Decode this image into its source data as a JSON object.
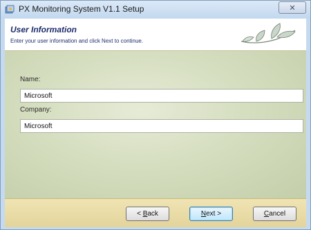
{
  "window": {
    "title": "PX Monitoring System V1.1 Setup",
    "close_glyph": "✕"
  },
  "header": {
    "title": "User Information",
    "subtitle": "Enter your user information and click Next to continue."
  },
  "form": {
    "name_label": "Name:",
    "name_value": "Microsoft",
    "company_label": "Company:",
    "company_value": "Microsoft"
  },
  "buttons": {
    "back": {
      "prefix": "< ",
      "mnemonic": "B",
      "rest": "ack"
    },
    "next": {
      "mnemonic": "N",
      "rest": "ext >"
    },
    "cancel": {
      "mnemonic": "C",
      "rest": "ancel"
    }
  },
  "icons": {
    "app": "setup-icon",
    "close": "close-icon",
    "banner": "leaf-logo-icon"
  },
  "colors": {
    "header_text": "#1e2c6b",
    "footer_bg": "#e8dba6",
    "content_bg": "#d2dbbb"
  }
}
